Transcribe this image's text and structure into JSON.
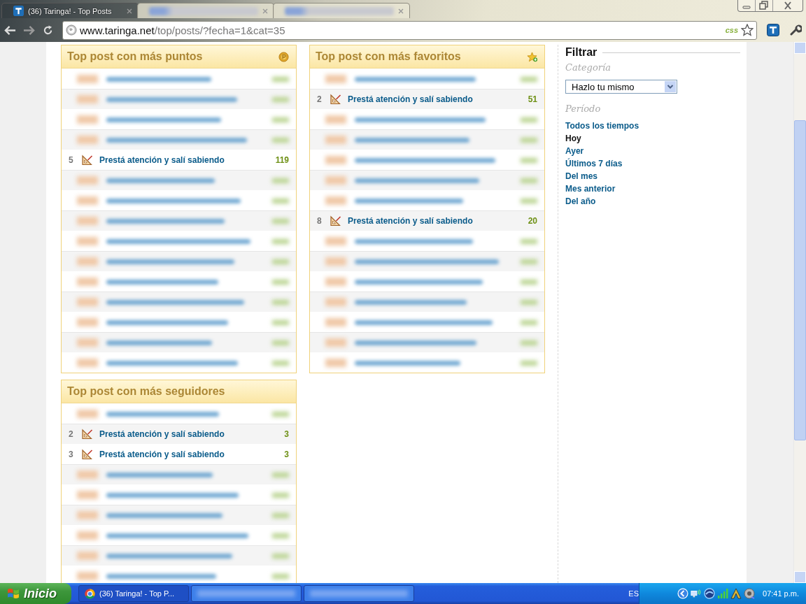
{
  "browser": {
    "tabs": [
      {
        "kind": "page",
        "title": "(36) Taringa! - Top Posts",
        "selected": true
      },
      {
        "kind": "blurred",
        "selected": false
      },
      {
        "kind": "blurred",
        "selected": false
      }
    ],
    "address_bar": {
      "host": "www.taringa.net",
      "path": "/top/posts/?fecha=1&cat=35",
      "badge": "css"
    }
  },
  "columns": [
    {
      "panels": [
        {
          "title": "Top post con más puntos",
          "kind": "points",
          "rows": [
            {
              "kind": "blurred"
            },
            {
              "kind": "blurred"
            },
            {
              "kind": "blurred"
            },
            {
              "kind": "blurred"
            },
            {
              "kind": "post",
              "rank": "5",
              "title": "Prestá atención y salí sabiendo",
              "count": "119"
            },
            {
              "kind": "blurred"
            },
            {
              "kind": "blurred"
            },
            {
              "kind": "blurred"
            },
            {
              "kind": "blurred"
            },
            {
              "kind": "blurred"
            },
            {
              "kind": "blurred"
            },
            {
              "kind": "blurred"
            },
            {
              "kind": "blurred"
            },
            {
              "kind": "blurred"
            },
            {
              "kind": "blurred"
            }
          ]
        },
        {
          "title": "Top post con más seguidores",
          "kind": "followers",
          "rows": [
            {
              "kind": "blurred"
            },
            {
              "kind": "post",
              "rank": "2",
              "title": "Prestá atención y salí sabiendo",
              "count": "3"
            },
            {
              "kind": "post",
              "rank": "3",
              "title": "Prestá atención y salí sabiendo",
              "count": "3"
            },
            {
              "kind": "blurred"
            },
            {
              "kind": "blurred"
            },
            {
              "kind": "blurred"
            },
            {
              "kind": "blurred"
            },
            {
              "kind": "blurred"
            },
            {
              "kind": "blurred"
            }
          ]
        }
      ]
    },
    {
      "panels": [
        {
          "title": "Top post con más favoritos",
          "kind": "favorites",
          "rows": [
            {
              "kind": "blurred"
            },
            {
              "kind": "post",
              "rank": "2",
              "title": "Prestá atención y salí sabiendo",
              "count": "51"
            },
            {
              "kind": "blurred"
            },
            {
              "kind": "blurred"
            },
            {
              "kind": "blurred"
            },
            {
              "kind": "blurred"
            },
            {
              "kind": "blurred"
            },
            {
              "kind": "post",
              "rank": "8",
              "title": "Prestá atención y salí sabiendo",
              "count": "20"
            },
            {
              "kind": "blurred"
            },
            {
              "kind": "blurred"
            },
            {
              "kind": "blurred"
            },
            {
              "kind": "blurred"
            },
            {
              "kind": "blurred"
            },
            {
              "kind": "blurred"
            },
            {
              "kind": "blurred"
            }
          ]
        }
      ]
    }
  ],
  "filter": {
    "title": "Filtrar",
    "category_label": "Categoría",
    "category": "Hazlo tu mismo",
    "period_label": "Período",
    "periods": [
      {
        "label": "Todos los tiempos",
        "selected": false
      },
      {
        "label": "Hoy",
        "selected": true
      },
      {
        "label": "Ayer",
        "selected": false
      },
      {
        "label": "Últimos 7 días",
        "selected": false
      },
      {
        "label": "Del mes",
        "selected": false
      },
      {
        "label": "Mes anterior",
        "selected": false
      },
      {
        "label": "Del año",
        "selected": false
      }
    ]
  },
  "taskbar": {
    "start": "Inicio",
    "tasks": [
      {
        "kind": "app",
        "title": "(36) Taringa! - Top P..."
      },
      {
        "kind": "blurred"
      },
      {
        "kind": "blurred"
      }
    ],
    "language": "ES",
    "clock": "07:41 p.m."
  }
}
